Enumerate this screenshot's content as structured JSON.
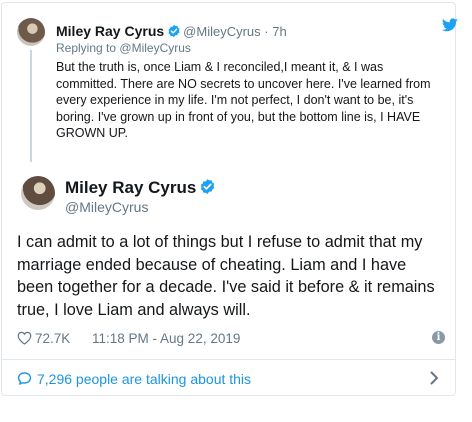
{
  "reply": {
    "name": "Miley Ray Cyrus",
    "handle": "@MileyCyrus",
    "separator": "·",
    "time": "7h",
    "replying_to_prefix": "Replying to",
    "replying_to_handle": "@MileyCyrus",
    "text": "But the truth is, once Liam & I reconciled,I meant it, & I was committed. There are NO secrets to uncover here. I've learned from every experience in my life. I'm not perfect, I don't want to be, it's boring. I've grown up in front of you, but the bottom line is, I HAVE GROWN UP."
  },
  "tweet": {
    "name": "Miley Ray Cyrus",
    "handle": "@MileyCyrus",
    "text": "I can admit to a lot of things but I refuse to admit that my marriage ended because of cheating. Liam and I have been together for a decade. I've said it before & it remains true, I love Liam and always will.",
    "likes": "72.7K",
    "timestamp": "11:18 PM - Aug 22, 2019",
    "info_glyph": "i"
  },
  "footer": {
    "talking": "7,296 people are talking about this"
  },
  "colors": {
    "accent": "#1da1f2",
    "link": "#1b95e0",
    "muted": "#657786",
    "border": "#e1e8ed"
  },
  "icons": [
    "verified-badge-icon",
    "twitter-bird-icon",
    "heart-icon",
    "info-icon",
    "speech-bubble-icon",
    "chevron-right-icon"
  ]
}
